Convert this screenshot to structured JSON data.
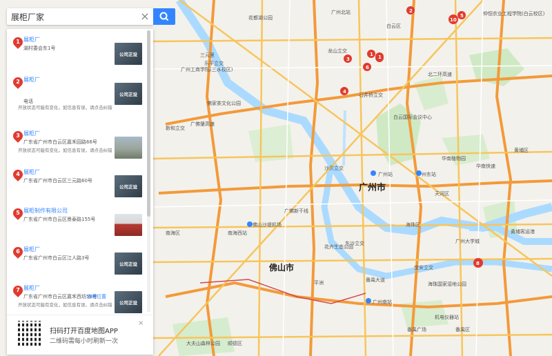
{
  "search": {
    "value": "展柜厂家",
    "clear_glyph": "×"
  },
  "results": [
    {
      "num": "1",
      "title": "展柜厂",
      "address": "湖村委会东1号",
      "phone": "",
      "notice": "",
      "thumb": "公司正设"
    },
    {
      "num": "2",
      "title": "展柜厂",
      "address": "",
      "phone": "电话",
      "notice": "开放状态可能有变化，如信息有误，请点击纠错",
      "thumb": "公司正设"
    },
    {
      "num": "3",
      "title": "展柜厂",
      "address": "广东省广州市白云区嘉禾园路66号",
      "phone": "",
      "notice": "开放状态可能有变化，如信息有误，请点击纠错",
      "photo": "street"
    },
    {
      "num": "4",
      "title": "展柜厂",
      "address": "广东省广州市白云区三元路60号",
      "phone": "",
      "notice": "",
      "thumb": "公司正设"
    },
    {
      "num": "5",
      "title": "展柜制作有限公司",
      "address": "广东省广州市白云区景泰路155号",
      "phone": "",
      "notice": "",
      "photo": "factory"
    },
    {
      "num": "6",
      "title": "展柜厂",
      "address": "广东省广州市白云区江人路3号",
      "phone": "",
      "notice": "",
      "thumb": "公司正设"
    },
    {
      "num": "7",
      "title": "展柜厂",
      "address": "广东省广州市白云区嘉禾西坊58号",
      "phone": "",
      "notice": "开放状态可能有变化，如信息有误，请点击纠错",
      "thumb": "公司正设",
      "extra": "查看位置"
    }
  ],
  "qr": {
    "title": "扫码打开百度地图APP",
    "subtitle": "二维码需每小时刷新一次",
    "close": "×"
  },
  "map": {
    "city": "广州市",
    "district_label": "佛山市",
    "labels": {
      "l1": "三元里",
      "l2": "乐平立交",
      "l3": "广州工商学院(三水校区)",
      "l4": "佛家茶文化公园",
      "l5": "新和立交",
      "l6": "广佛肇高速",
      "l7": "广州东站",
      "l8": "广州站",
      "l9": "广州南站",
      "l10": "天河区",
      "l11": "海珠区",
      "l12": "番禺区",
      "l13": "南海区",
      "l14": "顺德区",
      "l15": "白云区",
      "l16": "黄埔区",
      "l17": "广佛新干线",
      "l18": "沙贝立交",
      "l19": "南海西站",
      "l20": "石井桥立交",
      "l21": "龙山立交",
      "l22": "北二环高速",
      "l23": "广州北站",
      "l24": "华南快速",
      "l25": "宝安立交",
      "l26": "仲恺农业工程学院(白云校区)",
      "l27": "花都湖公园",
      "l28": "海珠国家湿地公园",
      "l29": "黄埔客运港",
      "l30": "机电仪器站",
      "l31": "大夫山森林公园",
      "l32": "广州大学城",
      "l33": "番禺广场",
      "l34": "花卉生态公园",
      "l35": "白云国际会议中心",
      "l36": "佛山沙堤机场",
      "l37": "番禺大道",
      "l38": "华南植物园",
      "l39": "东沙立交",
      "l40": "平洲"
    },
    "markers": [
      "1",
      "1",
      "2",
      "3",
      "4",
      "5",
      "6",
      "7",
      "8",
      "10"
    ]
  },
  "colors": {
    "accent": "#3385ff",
    "marker": "#e03b2f",
    "road": "#f7c55b",
    "highway": "#f39a3a",
    "water": "#aadaff",
    "park": "#cfe9c4"
  },
  "icons": {
    "search": "search-icon",
    "clear": "close-icon",
    "pin": "location-pin-icon",
    "notice": "info-tag-icon"
  }
}
